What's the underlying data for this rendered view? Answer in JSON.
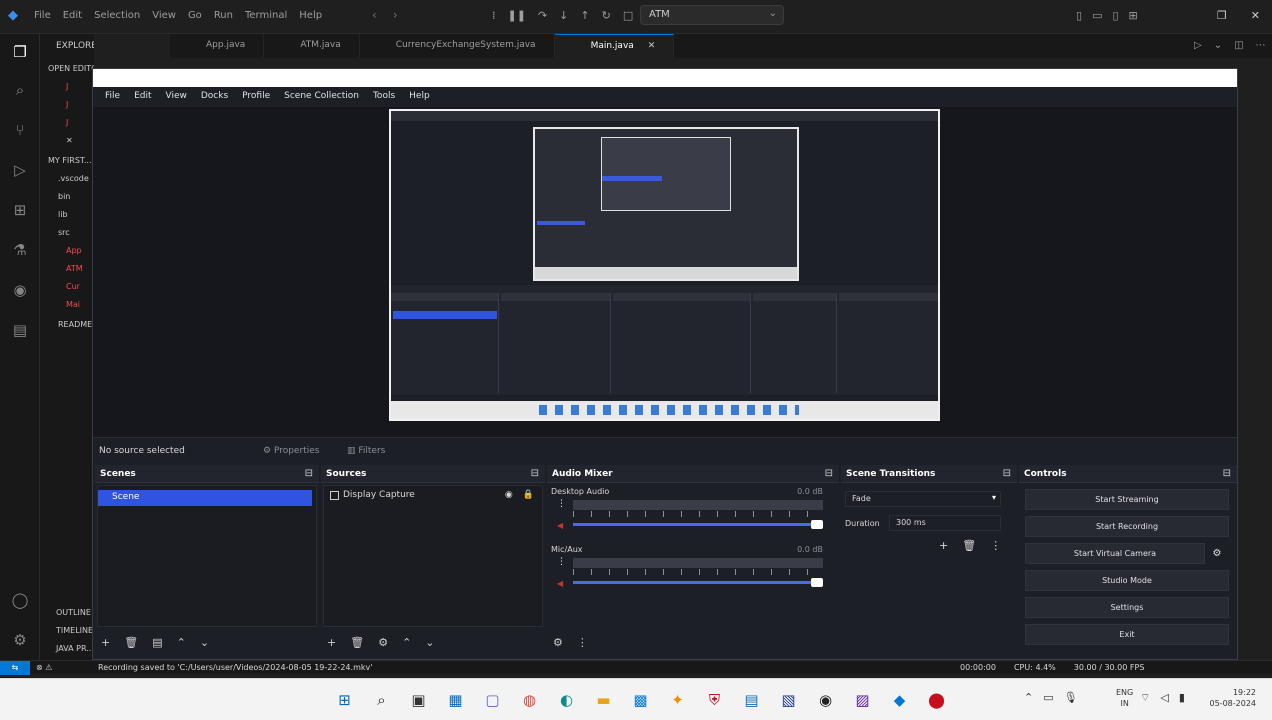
{
  "vscode": {
    "menu": [
      "File",
      "Edit",
      "Selection",
      "View",
      "Go",
      "Run",
      "Terminal",
      "Help"
    ],
    "command_center": "ATM",
    "tabs": [
      {
        "label": "App.java",
        "active": false
      },
      {
        "label": "ATM.java",
        "active": false
      },
      {
        "label": "CurrencyExchangeSystem.java",
        "active": false
      },
      {
        "label": "Main.java",
        "active": true
      }
    ],
    "explorer_title": "EXPLORER",
    "open_editors": "OPEN EDITORS",
    "project": "MY FIRST...",
    "tree": [
      ".vscode",
      "bin",
      "lib",
      "src",
      "App",
      "ATM",
      "Cur",
      "Mai",
      "README"
    ],
    "outline": "OUTLINE",
    "timeline": "TIMELINE",
    "java_projects": "JAVA PR..."
  },
  "obs": {
    "menu": [
      "File",
      "Edit",
      "View",
      "Docks",
      "Profile",
      "Scene Collection",
      "Tools",
      "Help"
    ],
    "no_source": "No source selected",
    "properties": "Properties",
    "filters": "Filters",
    "scenes": {
      "title": "Scenes",
      "items": [
        "Scene"
      ]
    },
    "sources": {
      "title": "Sources",
      "items": [
        "Display Capture"
      ]
    },
    "mixer": {
      "title": "Audio Mixer",
      "channels": [
        {
          "name": "Desktop Audio",
          "db": "0.0 dB"
        },
        {
          "name": "Mic/Aux",
          "db": "0.0 dB"
        }
      ]
    },
    "transitions": {
      "title": "Scene Transitions",
      "selected": "Fade",
      "duration_label": "Duration",
      "duration": "300 ms"
    },
    "controls": {
      "title": "Controls",
      "buttons": [
        "Start Streaming",
        "Start Recording",
        "Start Virtual Camera",
        "Studio Mode",
        "Settings",
        "Exit"
      ]
    },
    "status": {
      "saved": "Recording saved to 'C:/Users/user/Videos/2024-08-05 19-22-24.mkv'",
      "recording_time": "00:00:00",
      "cpu": "CPU: 4.4%",
      "fps": "30.00 / 30.00 FPS"
    }
  },
  "taskbar": {
    "lang": "ENG\nIN",
    "time": "19:22",
    "date": "05-08-2024"
  },
  "colors": {
    "accent": "#0078d4",
    "obs_select": "#2f55e0"
  }
}
